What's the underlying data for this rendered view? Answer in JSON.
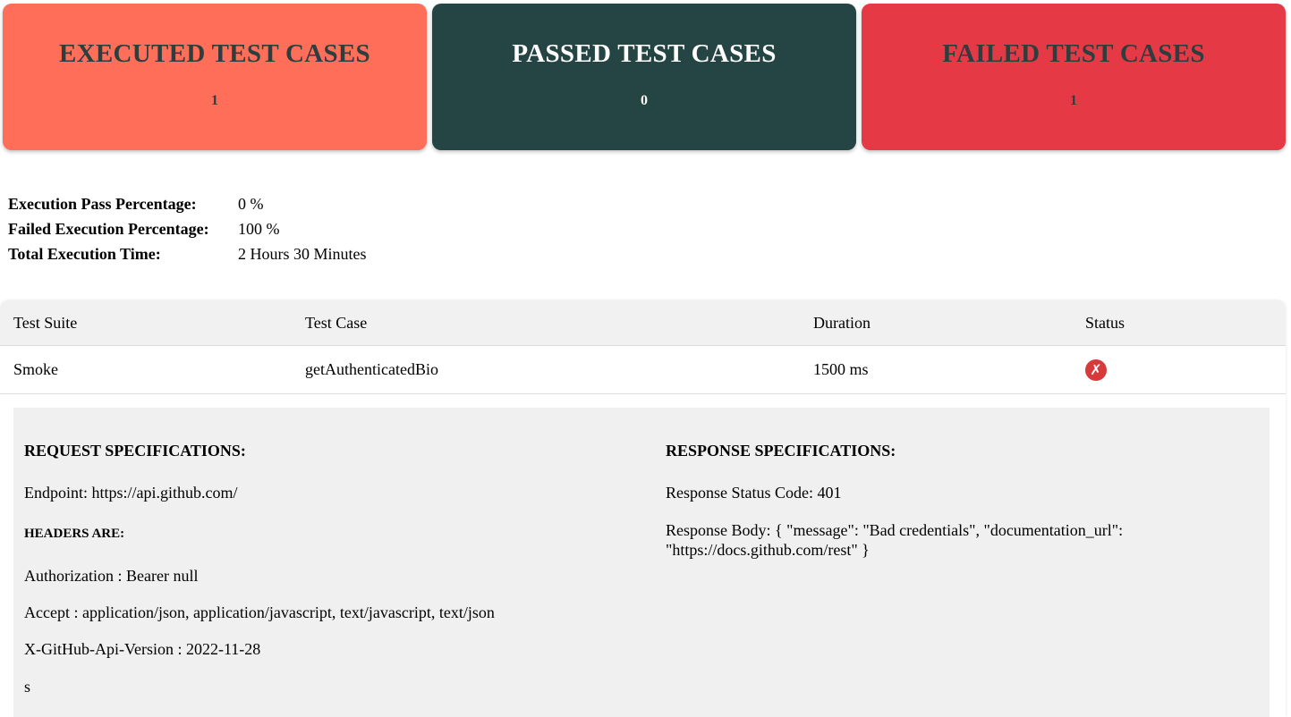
{
  "cards": {
    "executed": {
      "title": "EXECUTED TEST CASES",
      "count": "1",
      "color": "#ff6e58"
    },
    "passed": {
      "title": "PASSED TEST CASES",
      "count": "0",
      "color": "#254444"
    },
    "failed": {
      "title": "FAILED TEST CASES",
      "count": "1",
      "color": "#e63946"
    }
  },
  "summary": {
    "pass_label": "Execution Pass Percentage:",
    "pass_value": "0 %",
    "fail_label": "Failed Execution Percentage:",
    "fail_value": "100 %",
    "time_label": "Total Execution Time:",
    "time_value": "2 Hours 30 Minutes"
  },
  "table": {
    "headers": [
      "Test Suite",
      "Test Case",
      "Duration",
      "Status"
    ],
    "rows": [
      {
        "suite": "Smoke",
        "case": "getAuthenticatedBio",
        "duration": "1500 ms",
        "status_icon": "failed-x-icon",
        "status_glyph": "✗"
      }
    ]
  },
  "details": {
    "request": {
      "heading": "REQUEST SPECIFICATIONS:",
      "endpoint": "Endpoint: https://api.github.com/",
      "headers_heading": "HEADERS ARE:",
      "headers": [
        "Authorization : Bearer null",
        "Accept : application/json, application/javascript, text/javascript, text/json",
        "X-GitHub-Api-Version : 2022-11-28"
      ],
      "trailing": "s"
    },
    "response": {
      "heading": "RESPONSE SPECIFICATIONS:",
      "status_code": "Response Status Code: 401",
      "body": "Response Body: { \"message\": \"Bad credentials\", \"documentation_url\": \"https://docs.github.com/rest\" }"
    }
  }
}
